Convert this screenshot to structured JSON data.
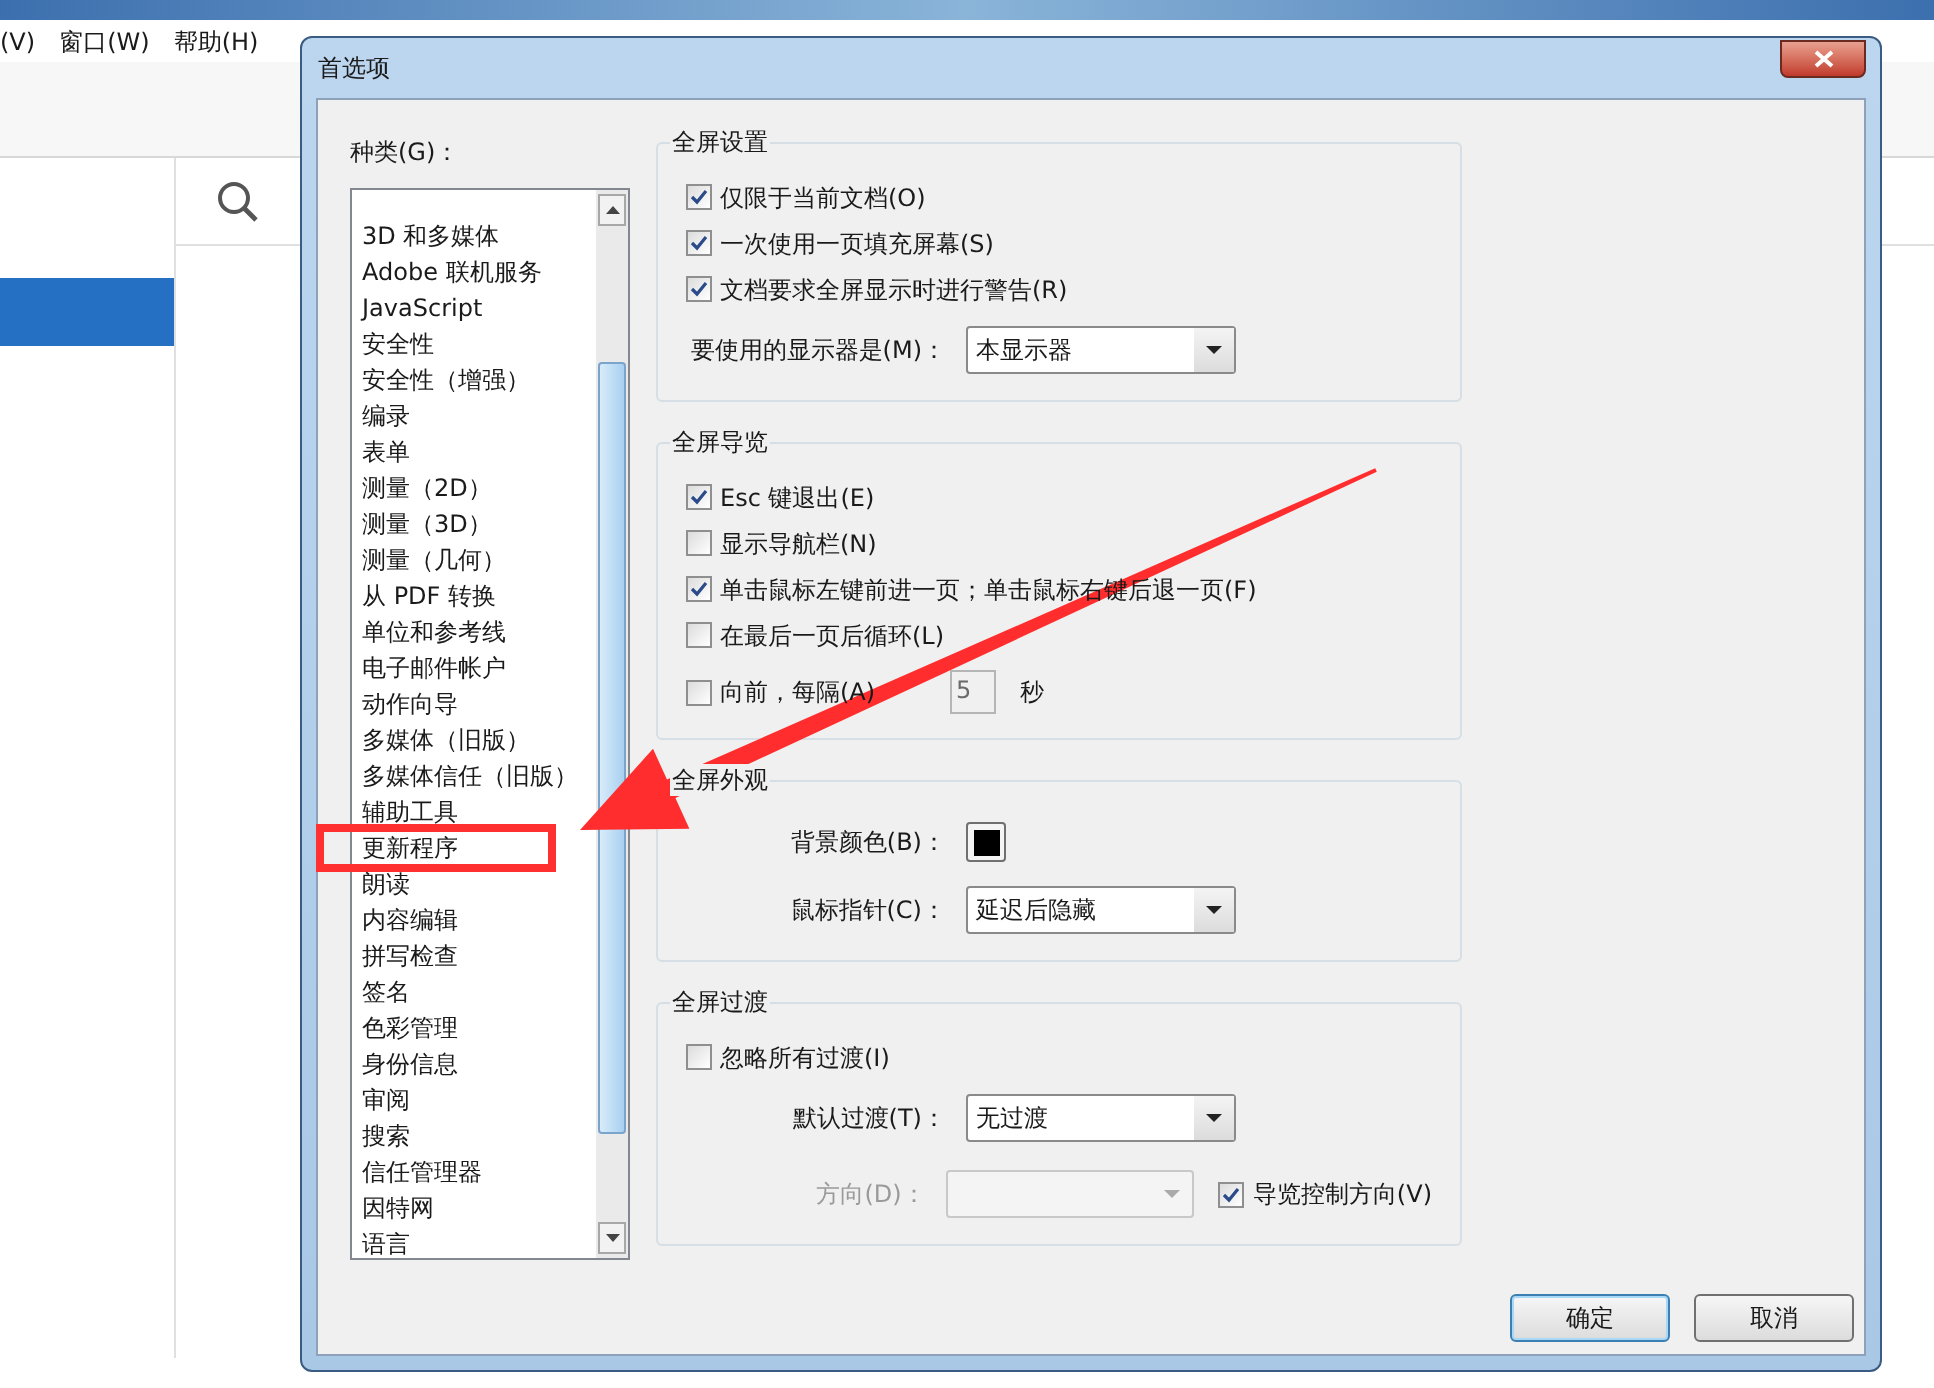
{
  "app": {
    "menu": [
      "(V)",
      "窗口(W)",
      "帮助(H)"
    ]
  },
  "dialog": {
    "title": "首选项",
    "categories_label": "种类(G)：",
    "categories": [
      {
        "label": "3D 和多媒体",
        "highlighted": false
      },
      {
        "label": "Adobe 联机服务",
        "highlighted": false
      },
      {
        "label": "JavaScript",
        "highlighted": false
      },
      {
        "label": "安全性",
        "highlighted": false
      },
      {
        "label": "安全性（增强）",
        "highlighted": false
      },
      {
        "label": "编录",
        "highlighted": false
      },
      {
        "label": "表单",
        "highlighted": false
      },
      {
        "label": "测量（2D）",
        "highlighted": false
      },
      {
        "label": "测量（3D）",
        "highlighted": false
      },
      {
        "label": "测量（几何）",
        "highlighted": false
      },
      {
        "label": "从 PDF 转换",
        "highlighted": false
      },
      {
        "label": "单位和参考线",
        "highlighted": false
      },
      {
        "label": "电子邮件帐户",
        "highlighted": false
      },
      {
        "label": "动作向导",
        "highlighted": false
      },
      {
        "label": "多媒体（旧版）",
        "highlighted": false
      },
      {
        "label": "多媒体信任（旧版）",
        "highlighted": false
      },
      {
        "label": "辅助工具",
        "highlighted": false
      },
      {
        "label": "更新程序",
        "highlighted": true
      },
      {
        "label": "朗读",
        "highlighted": false
      },
      {
        "label": "内容编辑",
        "highlighted": false
      },
      {
        "label": "拼写检查",
        "highlighted": false
      },
      {
        "label": "签名",
        "highlighted": false
      },
      {
        "label": "色彩管理",
        "highlighted": false
      },
      {
        "label": "身份信息",
        "highlighted": false
      },
      {
        "label": "审阅",
        "highlighted": false
      },
      {
        "label": "搜索",
        "highlighted": false
      },
      {
        "label": "信任管理器",
        "highlighted": false
      },
      {
        "label": "因特网",
        "highlighted": false
      },
      {
        "label": "语言",
        "highlighted": false
      }
    ],
    "groups": [
      {
        "title": "全屏设置",
        "rows": [
          {
            "kind": "checkbox",
            "label": "仅限于当前文档(O)",
            "checked": true
          },
          {
            "kind": "checkbox",
            "label": "一次使用一页填充屏幕(S)",
            "checked": true
          },
          {
            "kind": "checkbox",
            "label": "文档要求全屏显示时进行警告(R)",
            "checked": true
          },
          {
            "kind": "select",
            "label": "要使用的显示器是(M)：",
            "value": "本显示器",
            "disabled": false
          }
        ]
      },
      {
        "title": "全屏导览",
        "rows": [
          {
            "kind": "checkbox",
            "label": "Esc 键退出(E)",
            "checked": true
          },
          {
            "kind": "checkbox",
            "label": "显示导航栏(N)",
            "checked": false
          },
          {
            "kind": "checkbox",
            "label": "单击鼠标左键前进一页；单击鼠标右键后退一页(F)",
            "checked": true
          },
          {
            "kind": "checkbox",
            "label": "在最后一页后循环(L)",
            "checked": false
          },
          {
            "kind": "interval",
            "label": "向前，每隔(A)",
            "checked": false,
            "value": "5",
            "unit": "秒",
            "disabled": true
          }
        ]
      },
      {
        "title": "全屏外观",
        "rows": [
          {
            "kind": "color",
            "label": "背景颜色(B)：",
            "color": "#000000"
          },
          {
            "kind": "select",
            "label": "鼠标指针(C)：",
            "value": "延迟后隐藏",
            "disabled": false
          }
        ]
      },
      {
        "title": "全屏过渡",
        "rows": [
          {
            "kind": "checkbox",
            "label": "忽略所有过渡(I)",
            "checked": false
          },
          {
            "kind": "select",
            "label": "默认过渡(T)：",
            "value": "无过渡",
            "disabled": false
          },
          {
            "kind": "select",
            "label": "方向(D)：",
            "disabled": true,
            "extra": {
              "label": "导览控制方向(V)",
              "checked": true
            }
          }
        ]
      }
    ],
    "buttons": [
      {
        "label": "确定",
        "default": true
      },
      {
        "label": "取消",
        "default": false
      }
    ]
  }
}
